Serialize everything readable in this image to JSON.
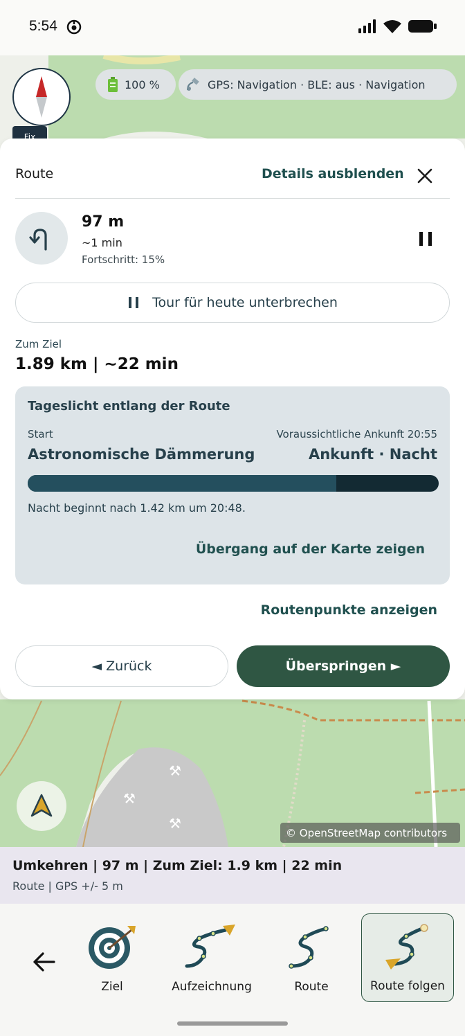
{
  "status_bar": {
    "time": "5:54"
  },
  "map_overlay": {
    "fix_label": "Fix",
    "battery_chip": {
      "icon": "battery-icon",
      "text": "100 %"
    },
    "gps_chip": {
      "icon": "satellite-icon",
      "text": "GPS: Navigation · BLE: aus · Navigation"
    },
    "attribution": "© OpenStreetMap contributors"
  },
  "route_sheet": {
    "title": "Route",
    "toggle_details": "Details ausblenden",
    "next_turn": {
      "icon": "u-turn-icon",
      "distance": "97 m",
      "time": "~1 min",
      "progress_text": "Fortschritt: 15%"
    },
    "pause_tour": "Tour für heute unterbrechen",
    "goal": {
      "label": "Zum Ziel",
      "value": "1.89 km | ~22 min"
    },
    "daylight": {
      "title": "Tageslicht entlang der Route",
      "start_label": "Start",
      "start_value": "Astronomische Dämmerung",
      "arrival_label": "Voraussichtliche Ankunft 20:55",
      "arrival_value": "Ankunft · Nacht",
      "bar_fill_fraction": 0.751,
      "note": "Nacht beginnt nach 1.42 km um 20:48.",
      "show_transition": "Übergang auf der Karte zeigen",
      "colors": {
        "day": "#244f5e",
        "night": "#132a33"
      }
    },
    "show_waypoints": "Routenpunkte anzeigen",
    "back_button": "◄ Zurück",
    "skip_button": "Überspringen ►"
  },
  "summary": {
    "main": "Umkehren  |  97 m  |  Zum Ziel: 1.9 km  |  22 min",
    "sub": "Route  |  GPS +/- 5 m"
  },
  "toolbar": {
    "tools": [
      {
        "label": "Ziel",
        "icon": "target-icon"
      },
      {
        "label": "Aufzeichnung",
        "icon": "recording-path-icon"
      },
      {
        "label": "Route",
        "icon": "route-path-icon"
      },
      {
        "label": "Route folgen",
        "icon": "follow-route-icon"
      }
    ]
  },
  "colors": {
    "accent": "#2f5643",
    "link": "#20504f",
    "forest": "#b7d8a8",
    "quarry": "#c8c8c8"
  }
}
